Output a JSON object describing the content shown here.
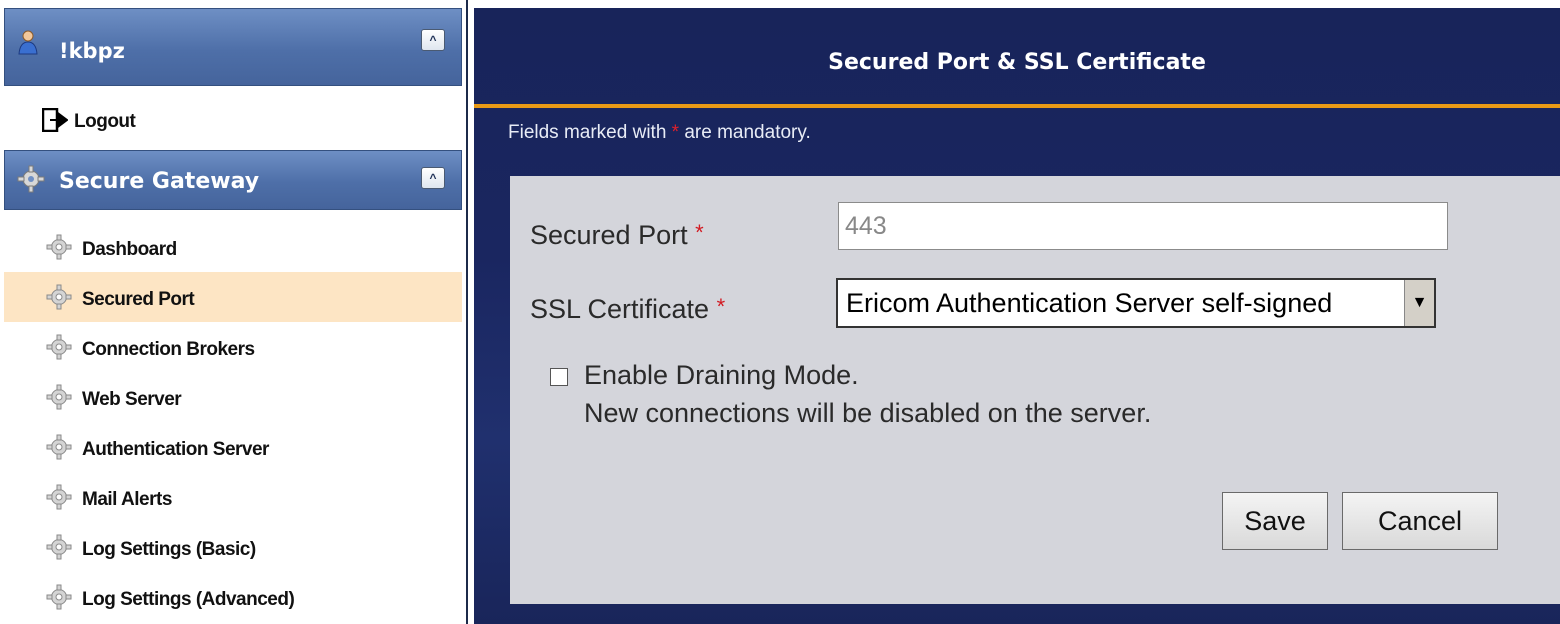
{
  "sidebar": {
    "user": {
      "name": "!kbpz",
      "collapse_symbol": "^"
    },
    "logout_label": "Logout",
    "section": {
      "title": "Secure Gateway",
      "collapse_symbol": "^"
    },
    "items": [
      {
        "label": "Dashboard",
        "active": false
      },
      {
        "label": "Secured Port",
        "active": true
      },
      {
        "label": "Connection Brokers",
        "active": false
      },
      {
        "label": "Web Server",
        "active": false
      },
      {
        "label": "Authentication Server",
        "active": false
      },
      {
        "label": "Mail Alerts",
        "active": false
      },
      {
        "label": "Log Settings (Basic)",
        "active": false
      },
      {
        "label": "Log Settings (Advanced)",
        "active": false
      }
    ]
  },
  "main": {
    "title": "Secured Port & SSL Certificate",
    "mandatory_note": {
      "before": "Fields marked with ",
      "star": "*",
      "after": " are mandatory."
    },
    "form": {
      "port_label": "Secured Port",
      "port_value": "443",
      "ssl_label": "SSL Certificate",
      "ssl_value": "Ericom Authentication Server self-signed",
      "required_marker": "*",
      "draining_label": "Enable Draining Mode.",
      "draining_note": "New connections will be disabled on the server.",
      "draining_checked": false,
      "save_label": "Save",
      "cancel_label": "Cancel"
    }
  },
  "colors": {
    "header_blue": "#4e6fa8",
    "panel_navy": "#1a2660",
    "accent_orange": "#e99a16",
    "active_item": "#fde5c4",
    "required_red": "#d21a22"
  }
}
